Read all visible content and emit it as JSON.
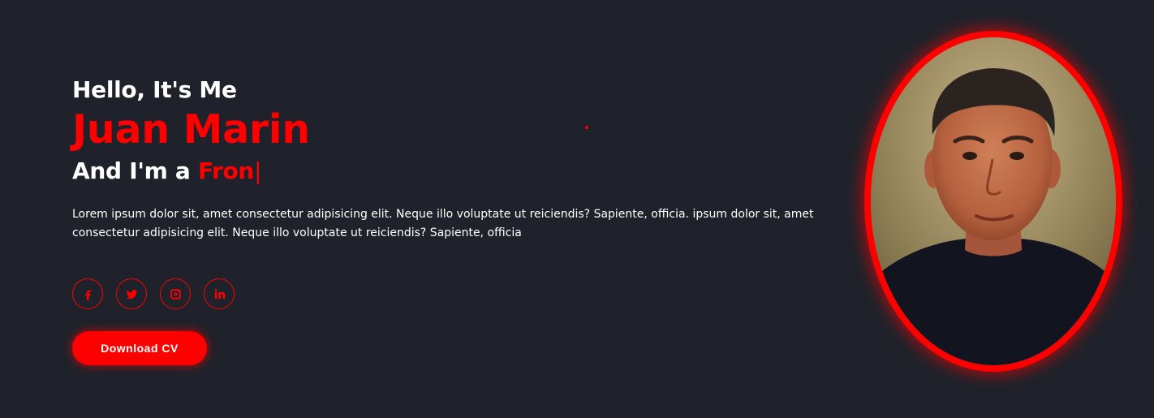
{
  "hero": {
    "greeting": "Hello, It's Me",
    "name": "Juan Marin",
    "role_prefix": "And I'm a ",
    "role_typed": "Fron",
    "cursor": "|",
    "description": "Lorem ipsum dolor sit, amet consectetur adipisicing elit. Neque illo voluptate ut reiciendis? Sapiente, officia. ipsum dolor sit, amet consectetur adipisicing elit. Neque illo voluptate ut reiciendis? Sapiente, officia",
    "download_label": "Download CV"
  },
  "socials": [
    {
      "icon": "facebook-icon",
      "glyph": "f"
    },
    {
      "icon": "twitter-icon",
      "glyph": "t"
    },
    {
      "icon": "instagram-icon",
      "glyph": "ig"
    },
    {
      "icon": "linkedin-icon",
      "glyph": "in"
    }
  ],
  "colors": {
    "background": "#1f222a",
    "accent": "#ff0000",
    "text": "#ffffff"
  }
}
